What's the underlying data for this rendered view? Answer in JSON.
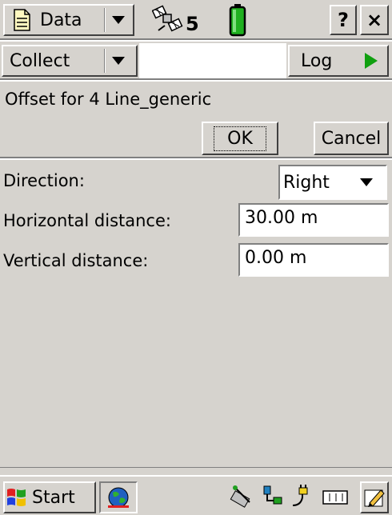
{
  "topbar": {
    "data_menu_label": "Data",
    "satellite_count": "5",
    "help_label": "?",
    "close_label": "×"
  },
  "collectbar": {
    "collect_label": "Collect",
    "log_label": "Log"
  },
  "offset": {
    "title": "Offset for 4 Line_generic",
    "ok_label": "OK",
    "cancel_label": "Cancel"
  },
  "form": {
    "direction_label": "Direction:",
    "direction_value": "Right",
    "horizontal_label": "Horizontal distance:",
    "horizontal_value": "30.00 m",
    "vertical_label": "Vertical distance:",
    "vertical_value": "0.00 m"
  },
  "taskbar": {
    "start_label": "Start"
  },
  "colors": {
    "chrome": "#d6d3ce",
    "play_green": "#10a010",
    "battery_green": "#20b020"
  }
}
